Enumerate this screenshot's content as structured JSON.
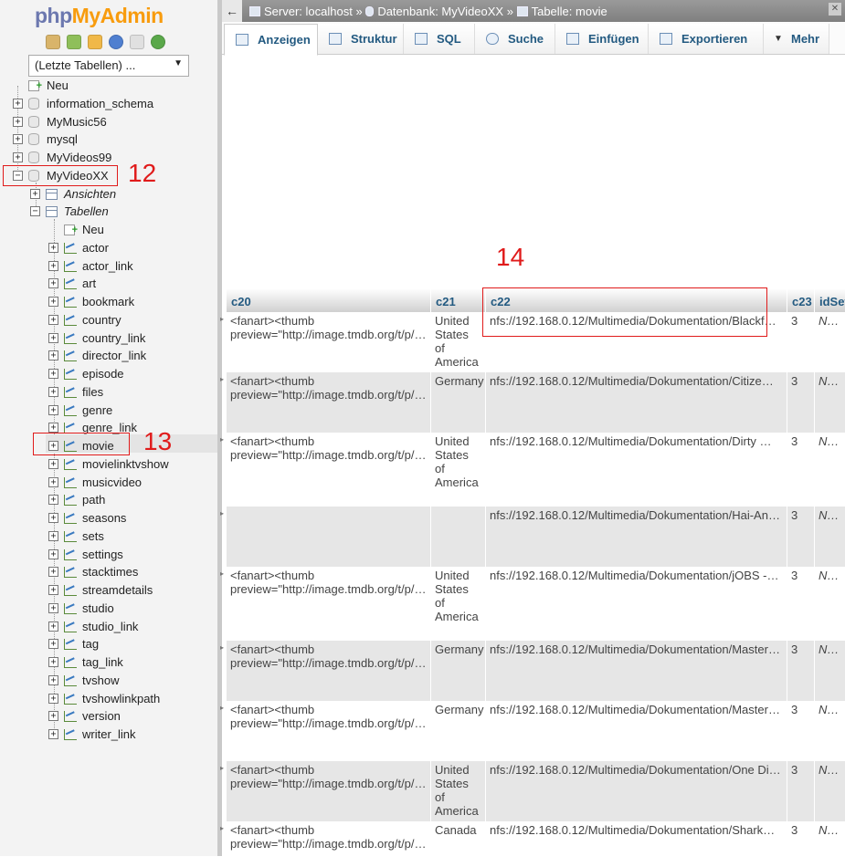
{
  "logo": {
    "php": "php",
    "admin": "MyAdmin"
  },
  "quick_icons": [
    "home-icon",
    "logout-icon",
    "sql-icon",
    "help-icon",
    "docs-icon",
    "reload-icon"
  ],
  "recent_tables": {
    "selected": "(Letzte Tabellen) ..."
  },
  "tree": {
    "new_label": "Neu",
    "databases": [
      "information_schema",
      "MyMusic56",
      "mysql",
      "MyVideos99",
      "MyVideoXX"
    ],
    "views_label": "Ansichten",
    "tables_label": "Tabellen",
    "tables_new": "Neu",
    "tables": [
      "actor",
      "actor_link",
      "art",
      "bookmark",
      "country",
      "country_link",
      "director_link",
      "episode",
      "files",
      "genre",
      "genre_link",
      "movie",
      "movielinktvshow",
      "musicvideo",
      "path",
      "seasons",
      "sets",
      "settings",
      "stacktimes",
      "streamdetails",
      "studio",
      "studio_link",
      "tag",
      "tag_link",
      "tvshow",
      "tvshowlinkpath",
      "version",
      "writer_link"
    ],
    "selected_table": "movie"
  },
  "breadcrumb": {
    "server": "Server: localhost",
    "database": "Datenbank: MyVideoXX",
    "table": "Tabelle: movie",
    "sep": "»"
  },
  "tabs": [
    "Anzeigen",
    "Struktur",
    "SQL",
    "Suche",
    "Einfügen",
    "Exportieren",
    "Mehr"
  ],
  "columns": [
    "c20",
    "c21",
    "c22",
    "c23",
    "idSet"
  ],
  "rows": [
    {
      "c20": "<fanart><thumb\npreview=\"http://image.tmdb.org/t/p/…",
      "c21": "United\nStates of\nAmerica",
      "c22": "nfs://192.168.0.12/Multimedia/Dokumentation/Blackf…",
      "c23": "3",
      "idSet": "NULL"
    },
    {
      "c20": "<fanart><thumb\npreview=\"http://image.tmdb.org/t/p/…",
      "c21": "Germany",
      "c22": "nfs://192.168.0.12/Multimedia/Dokumentation/Citize…",
      "c23": "3",
      "idSet": "NULL"
    },
    {
      "c20": "<fanart><thumb\npreview=\"http://image.tmdb.org/t/p/…",
      "c21": "United\nStates of\nAmerica",
      "c22": "nfs://192.168.0.12/Multimedia/Dokumentation/Dirty …",
      "c23": "3",
      "idSet": "NULL"
    },
    {
      "c20": "",
      "c21": "",
      "c22": "nfs://192.168.0.12/Multimedia/Dokumentation/Hai-An…",
      "c23": "3",
      "idSet": "NULL"
    },
    {
      "c20": "<fanart><thumb\npreview=\"http://image.tmdb.org/t/p/…",
      "c21": "United\nStates of\nAmerica",
      "c22": "nfs://192.168.0.12/Multimedia/Dokumentation/jOBS -…",
      "c23": "3",
      "idSet": "NULL"
    },
    {
      "c20": "<fanart><thumb\npreview=\"http://image.tmdb.org/t/p/…",
      "c21": "Germany",
      "c22": "nfs://192.168.0.12/Multimedia/Dokumentation/Master…",
      "c23": "3",
      "idSet": "NULL"
    },
    {
      "c20": "<fanart><thumb\npreview=\"http://image.tmdb.org/t/p/…",
      "c21": "Germany",
      "c22": "nfs://192.168.0.12/Multimedia/Dokumentation/Master…",
      "c23": "3",
      "idSet": "NULL"
    },
    {
      "c20": "<fanart><thumb\npreview=\"http://image.tmdb.org/t/p/…",
      "c21": "United\nStates of\nAmerica",
      "c22": "nfs://192.168.0.12/Multimedia/Dokumentation/One Di…",
      "c23": "3",
      "idSet": "NULL"
    },
    {
      "c20": "<fanart><thumb\npreview=\"http://image.tmdb.org/t/p/…",
      "c21": "Canada",
      "c22": "nfs://192.168.0.12/Multimedia/Dokumentation/Sharkw…",
      "c23": "3",
      "idSet": "NULL"
    }
  ],
  "annotations": [
    "12",
    "13",
    "14"
  ],
  "colors": {
    "accent": "#235a81",
    "annotation": "#e01b1b",
    "row_alt": "#e6e6e6",
    "logo_php": "#6c78af",
    "logo_admin": "#f89c0e"
  }
}
